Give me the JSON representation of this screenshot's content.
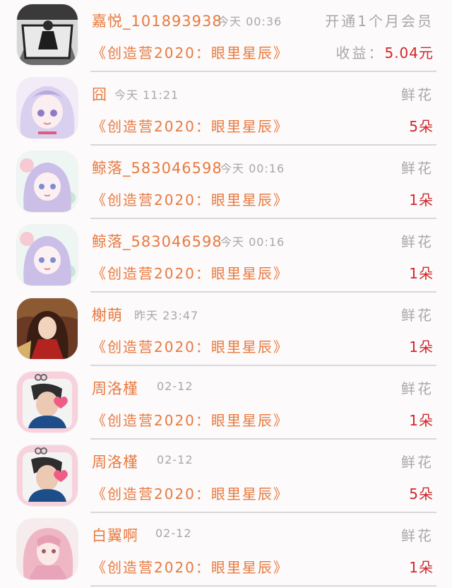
{
  "gifts": [
    {
      "user": "嘉悦_101893938",
      "time": "今天 00:36",
      "right_top": "开通1个月会员",
      "show": "《创造营2020：眼里星辰》",
      "right_label": "收益：",
      "right_value": "5.04元",
      "avatar": "avatar-photo-dark"
    },
    {
      "user": "囧",
      "time": "今天 11:21",
      "right_top": "鲜花",
      "show": "《创造营2020：眼里星辰》",
      "right_label": "",
      "right_value": "5朵",
      "avatar": "avatar-anime-purple"
    },
    {
      "user": "鲸落_583046598",
      "time": "今天 00:16",
      "right_top": "鲜花",
      "show": "《创造营2020：眼里星辰》",
      "right_label": "",
      "right_value": "1朵",
      "avatar": "avatar-anime-pastel"
    },
    {
      "user": "鲸落_583046598",
      "time": "今天 00:16",
      "right_top": "鲜花",
      "show": "《创造营2020：眼里星辰》",
      "right_label": "",
      "right_value": "1朵",
      "avatar": "avatar-anime-pastel"
    },
    {
      "user": "榭萌",
      "time": "昨天 23:47",
      "right_top": "鲜花",
      "show": "《创造营2020：眼里星辰》",
      "right_label": "",
      "right_value": "1朵",
      "avatar": "avatar-illustration-red"
    },
    {
      "user": "周洛槿",
      "time": "02-12",
      "right_top": "鲜花",
      "show": "《创造营2020：眼里星辰》",
      "right_label": "",
      "right_value": "1朵",
      "avatar": "avatar-photo-pink"
    },
    {
      "user": "周洛槿",
      "time": "02-12",
      "right_top": "鲜花",
      "show": "《创造营2020：眼里星辰》",
      "right_label": "",
      "right_value": "5朵",
      "avatar": "avatar-photo-pink"
    },
    {
      "user": "白翼啊",
      "time": "02-12",
      "right_top": "鲜花",
      "show": "《创造营2020：眼里星辰》",
      "right_label": "",
      "right_value": "1朵",
      "avatar": "avatar-anime-pink"
    }
  ]
}
